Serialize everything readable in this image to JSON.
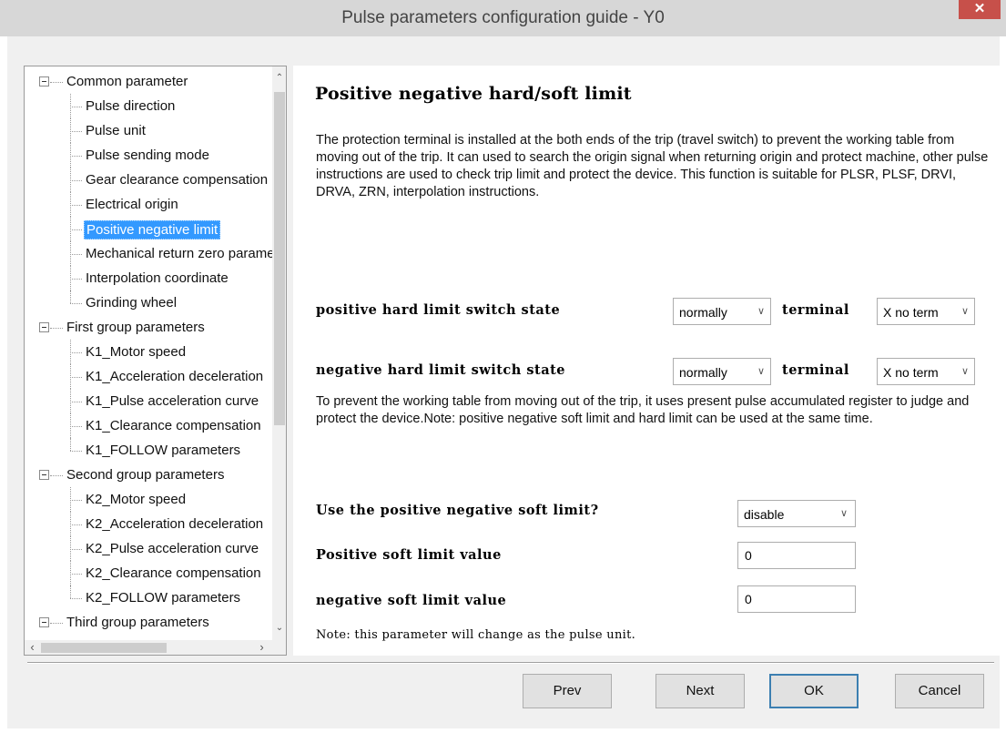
{
  "window": {
    "title": "Pulse parameters configuration guide - Y0",
    "close_glyph": "✕",
    "accent_close": "#c7504a"
  },
  "tree": {
    "items": [
      {
        "label": "Common parameter",
        "level": 0,
        "expanded": true
      },
      {
        "label": "Pulse direction",
        "level": 1
      },
      {
        "label": "Pulse unit",
        "level": 1
      },
      {
        "label": "Pulse sending mode",
        "level": 1
      },
      {
        "label": "Gear clearance compensation",
        "level": 1
      },
      {
        "label": "Electrical origin",
        "level": 1
      },
      {
        "label": "Positive negative limit",
        "level": 1,
        "selected": true
      },
      {
        "label": "Mechanical return zero parameters",
        "level": 1
      },
      {
        "label": "Interpolation coordinate",
        "level": 1
      },
      {
        "label": "Grinding wheel",
        "level": 1
      },
      {
        "label": "First group parameters",
        "level": 0,
        "expanded": true
      },
      {
        "label": "K1_Motor speed",
        "level": 1
      },
      {
        "label": "K1_Acceleration deceleration",
        "level": 1
      },
      {
        "label": "K1_Pulse acceleration curve",
        "level": 1
      },
      {
        "label": "K1_Clearance compensation",
        "level": 1
      },
      {
        "label": "K1_FOLLOW parameters",
        "level": 1
      },
      {
        "label": "Second group parameters",
        "level": 0,
        "expanded": true
      },
      {
        "label": "K2_Motor speed",
        "level": 1
      },
      {
        "label": "K2_Acceleration deceleration",
        "level": 1
      },
      {
        "label": "K2_Pulse acceleration curve",
        "level": 1
      },
      {
        "label": "K2_Clearance compensation",
        "level": 1
      },
      {
        "label": "K2_FOLLOW parameters",
        "level": 1
      },
      {
        "label": "Third group parameters",
        "level": 0,
        "expanded": true
      }
    ],
    "scroll_up_glyph": "⌃",
    "scroll_down_glyph": "⌄",
    "scroll_left_glyph": "‹",
    "scroll_right_glyph": "›"
  },
  "main": {
    "heading": "Positive negative hard/soft limit",
    "description1": "The protection terminal is installed at the both ends of the trip (travel switch) to prevent the working table from moving out of the trip. It can used to search the origin signal when returning origin and protect machine, other pulse instructions are used to check trip limit and protect the device. This function is suitable for PLSR, PLSF, DRVI, DRVA, ZRN, interpolation instructions.",
    "pos_hard_label": "positive hard limit switch state",
    "pos_hard_state": "normally",
    "pos_terminal_label": "terminal",
    "pos_terminal_value": "X no term",
    "neg_hard_label": "negative hard limit switch state",
    "neg_hard_state": "normally",
    "neg_terminal_label": "terminal",
    "neg_terminal_value": "X no term",
    "description2": "To prevent the working table from moving out of the trip, it uses present pulse accumulated register to judge and protect the device.Note: positive negative soft limit and hard limit can be used at the same time.",
    "soft_enable_label": "Use the positive negative soft limit?",
    "soft_enable_value": "disable",
    "pos_soft_label": "Positive soft limit value",
    "pos_soft_value": "0",
    "neg_soft_label": "negative soft limit value",
    "neg_soft_value": "0",
    "note": "Note: this parameter will change as the pulse unit.",
    "dropdown_glyph": "∨"
  },
  "buttons": {
    "prev": "Prev",
    "next": "Next",
    "ok": "OK",
    "cancel": "Cancel"
  }
}
